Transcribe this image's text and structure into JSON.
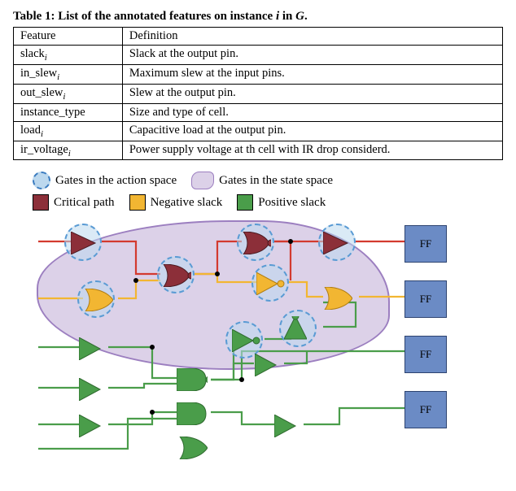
{
  "table": {
    "caption_prefix": "Table 1: List of the annotated features on instance ",
    "caption_var": "i",
    "caption_suffix1": " in ",
    "caption_var2": "G",
    "caption_suffix2": ".",
    "header": {
      "col1": "Feature",
      "col2": "Definition"
    },
    "rows": [
      {
        "feature": "slack",
        "sub": "i",
        "definition": "Slack at the output pin."
      },
      {
        "feature": "in_slew",
        "sub": "i",
        "definition": "Maximum slew at the input pins."
      },
      {
        "feature": "out_slew",
        "sub": "i",
        "definition": "Slew at the output pin."
      },
      {
        "feature": "instance_type",
        "sub": "",
        "definition": "Size and type of cell."
      },
      {
        "feature": "load",
        "sub": "i",
        "definition": "Capacitive load at the output pin."
      },
      {
        "feature": "ir_voltage",
        "sub": "i",
        "definition": "Power supply voltage at th cell with IR drop considerd."
      }
    ]
  },
  "legend": {
    "action_space": "Gates in the action space",
    "state_space": "Gates in the state space",
    "critical": "Critical path",
    "negative": "Negative slack",
    "positive": "Positive slack"
  },
  "ff_label": "FF",
  "colors": {
    "critical": "#8c2f39",
    "negative": "#f2b632",
    "positive": "#4a9d4a",
    "halo_border": "#5a9bd4",
    "halo_fill": "#bcd8ee",
    "state_fill": "#dcd1e8",
    "state_border": "#9c7fc0",
    "ff_fill": "#6b8bc5",
    "wire_red": "#d33a2f",
    "wire_yellow": "#f2b632",
    "wire_green": "#4a9d4a"
  }
}
